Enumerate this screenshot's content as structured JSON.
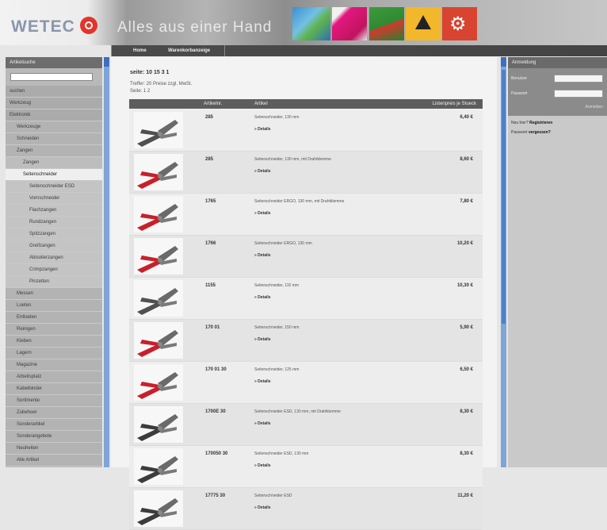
{
  "header": {
    "logo_text": "WETEC",
    "slogan": "Alles aus einer Hand"
  },
  "nav": {
    "tabs": [
      "Home",
      "Warenkorbanzeige"
    ]
  },
  "sidebar": {
    "heading": "Artikelsuche",
    "items": [
      {
        "label": "suchen",
        "level": 0
      },
      {
        "label": "Werkzeug",
        "level": 0
      },
      {
        "label": "Elektronik",
        "level": 0
      },
      {
        "label": "Werkzeuge",
        "level": 1
      },
      {
        "label": "Schneiden",
        "level": 1
      },
      {
        "label": "Zangen",
        "level": 1
      },
      {
        "label": "Zangen",
        "level": 2
      },
      {
        "label": "Seitenschneider",
        "level": 2,
        "active": true
      },
      {
        "label": "Seitenschneider ESD",
        "level": 3
      },
      {
        "label": "Vornschneider",
        "level": 3
      },
      {
        "label": "Flachzangen",
        "level": 3
      },
      {
        "label": "Rundzangen",
        "level": 3
      },
      {
        "label": "Spitzzangen",
        "level": 3
      },
      {
        "label": "Greifzangen",
        "level": 3
      },
      {
        "label": "Abisolierzangen",
        "level": 3
      },
      {
        "label": "Crimpzangen",
        "level": 3
      },
      {
        "label": "Pinzetten",
        "level": 3
      },
      {
        "label": "Messen",
        "level": 1
      },
      {
        "label": "Loeten",
        "level": 1
      },
      {
        "label": "Entloeten",
        "level": 1
      },
      {
        "label": "Reinigen",
        "level": 1
      },
      {
        "label": "Kleben",
        "level": 1
      },
      {
        "label": "Lagern",
        "level": 1
      },
      {
        "label": "Magazine",
        "level": 1
      },
      {
        "label": "Arbeitsplatz",
        "level": 1
      },
      {
        "label": "Kabelbinder",
        "level": 1
      },
      {
        "label": "Sortimente",
        "level": 1
      },
      {
        "label": "Zubehoer",
        "level": 1
      },
      {
        "label": "Sonderartikel",
        "level": 1
      },
      {
        "label": "Sonderangebote",
        "level": 1
      },
      {
        "label": "Neuheiten",
        "level": 1
      },
      {
        "label": "Alle Artikel",
        "level": 1
      }
    ]
  },
  "main": {
    "title": "seite: 10 15 3 1",
    "result_info": "Treffer: 20 Preise zzgl. MwSt.",
    "page_info": "Seite: 1 2",
    "columns": {
      "article": "Artikelnr.",
      "name": "Artikel",
      "price": "Listenpreis je Stueck"
    },
    "rows": [
      {
        "art": "285",
        "desc": "Seitenschneider, 130 mm",
        "more": "» Details",
        "price": "6,40 €",
        "handle": "#505050"
      },
      {
        "art": "285",
        "desc": "Seitenschneider, 130 mm, mit Drahtklemme",
        "more": "» Details",
        "price": "8,60 €",
        "handle": "#c8202a"
      },
      {
        "art": "1765",
        "desc": "Seitenschneider ERGO, 130 mm, mit Drahtklemme",
        "more": "» Details",
        "price": "7,80 €",
        "handle": "#c8202a"
      },
      {
        "art": "1766",
        "desc": "Seitenschneider ERGO, 130 mm",
        "more": "» Details",
        "price": "10,20 €",
        "handle": "#c8202a"
      },
      {
        "art": "1155",
        "desc": "Seitenschneider, 115 mm",
        "more": "» Details",
        "price": "10,30 €",
        "handle": "#505050"
      },
      {
        "art": "170 01",
        "desc": "Seitenschneider, 150 mm",
        "more": "» Details",
        "price": "5,90 €",
        "handle": "#c8202a"
      },
      {
        "art": "170 01 30",
        "desc": "Seitenschneider, 125 mm",
        "more": "» Details",
        "price": "6,50 €",
        "handle": "#c8202a"
      },
      {
        "art": "1700E 30",
        "desc": "Seitenschneider ESD, 130 mm, mit Drahtklemme",
        "more": "» Details",
        "price": "8,30 €",
        "handle": "#3c3c3c"
      },
      {
        "art": "170050 30",
        "desc": "Seitenschneider ESD, 130 mm",
        "more": "» Details",
        "price": "8,30 €",
        "handle": "#3c3c3c"
      },
      {
        "art": "17775 30",
        "desc": "Seitenschneider ESD",
        "more": "» Details",
        "price": "11,20 €",
        "handle": "#3c3c3c"
      }
    ]
  },
  "right": {
    "heading": "Anmeldung",
    "user_label": "Benutzer",
    "password_label": "Passwort",
    "login_link": "Anmelden",
    "links": [
      {
        "pre": "Neu hier? ",
        "bold": "Registrieren"
      },
      {
        "pre": "Passwort ",
        "bold": "vergessen?"
      }
    ]
  }
}
